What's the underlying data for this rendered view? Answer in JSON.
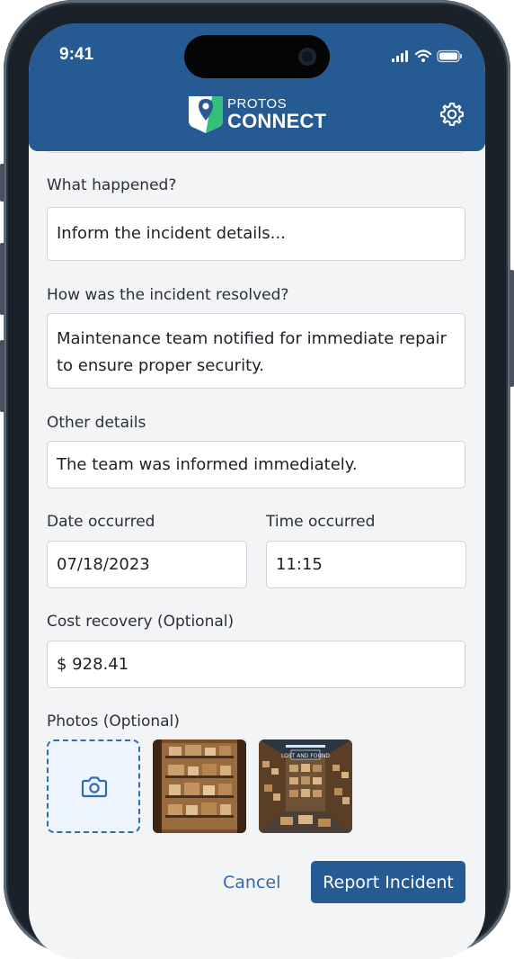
{
  "status_bar": {
    "time": "9:41"
  },
  "app": {
    "brand_top": "PROTOS",
    "brand_bottom": "CONNECT"
  },
  "colors": {
    "primary": "#265a92",
    "link": "#2f6ab0",
    "background": "#f3f4f6"
  },
  "icons": {
    "settings": "gear-icon",
    "camera": "camera-icon"
  },
  "form": {
    "what_happened": {
      "label": "What happened?",
      "placeholder": "Inform the incident details..."
    },
    "resolution": {
      "label": "How was the incident resolved?",
      "value": "Maintenance team notified for immediate repair to ensure proper security."
    },
    "other_details": {
      "label": "Other details",
      "value": "The team was informed immediately."
    },
    "date": {
      "label": "Date occurred",
      "value": "07/18/2023"
    },
    "time": {
      "label": "Time occurred",
      "value": "11:15"
    },
    "cost": {
      "label": "Cost recovery (Optional)",
      "value": "$ 928.41"
    },
    "photos": {
      "label": "Photos (Optional)",
      "sign_text": "LOST AND FOUND"
    }
  },
  "actions": {
    "cancel": "Cancel",
    "submit": "Report Incident"
  }
}
